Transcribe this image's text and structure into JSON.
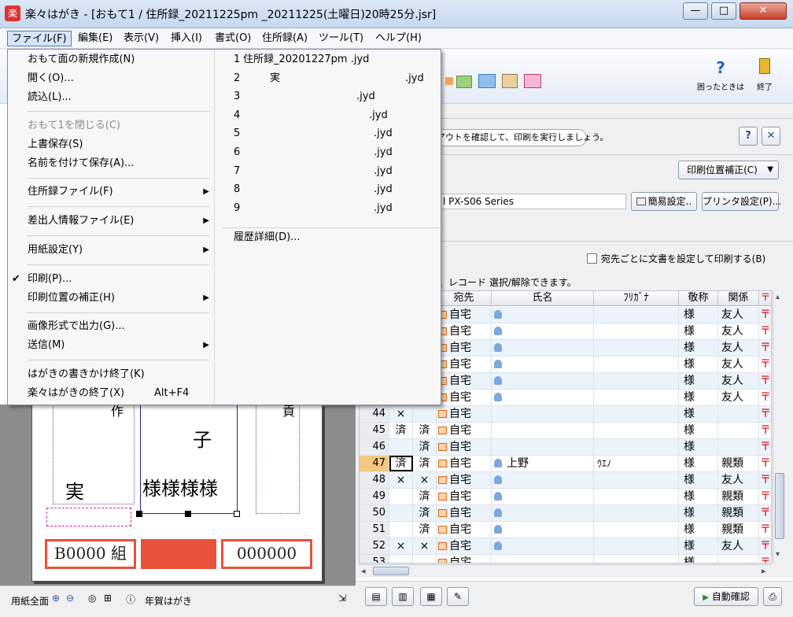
{
  "window": {
    "title": "楽々はがき - [おもて1 / 住所録_20211225pm _20211225(土曜日)20時25分.jsr]",
    "app_icon_char": "楽",
    "minimize": "—",
    "maximize": "□",
    "close": "✕"
  },
  "menubar": [
    "ファイル(F)",
    "編集(E)",
    "表示(V)",
    "挿入(I)",
    "書式(O)",
    "住所録(A)",
    "ツール(T)",
    "ヘルプ(H)"
  ],
  "toolbar": {
    "help_label": "困ったときは",
    "exit_label": "終了"
  },
  "file_menu": {
    "new_front": "おもて面の新規作成(N)",
    "open": "開く(O)...",
    "load": "読込(L)...",
    "close_front": "おもて1を閉じる(C)",
    "save": "上書保存(S)",
    "save_as": "名前を付けて保存(A)...",
    "address_file": "住所録ファイル(F)",
    "sender_file": "差出人情報ファイル(E)",
    "paper_settings": "用紙設定(Y)",
    "print": "印刷(P)...",
    "print_adjust": "印刷位置の補正(H)",
    "export_image": "画像形式で出力(G)...",
    "send": "送信(M)",
    "end_writing": "はがきの書きかけ終了(K)",
    "quit": "楽々はがきの終了(X)",
    "quit_shortcut": "Alt+F4",
    "check_mark": "✔",
    "submenu_arrow": "▶"
  },
  "history": {
    "items": [
      {
        "num": "1",
        "name": "住所録_20201227pm .jyd",
        "ext": ""
      },
      {
        "num": "2",
        "name": "実",
        "ext": ".jyd"
      },
      {
        "num": "3",
        "name": "",
        "ext": ".jyd"
      },
      {
        "num": "4",
        "name": "",
        "ext": ".jyd"
      },
      {
        "num": "5",
        "name": "",
        "ext": ".jyd"
      },
      {
        "num": "6",
        "name": "",
        "ext": ".jyd"
      },
      {
        "num": "7",
        "name": "",
        "ext": ".jyd"
      },
      {
        "num": "8",
        "name": "",
        "ext": ".jyd"
      },
      {
        "num": "9",
        "name": "",
        "ext": ".jyd"
      }
    ],
    "details": "履歴詳細(D)..."
  },
  "print_panel": {
    "guide_text": "アウトを確認して、印刷を実行しましょう。",
    "help_button": "?",
    "close_button": "✕",
    "position_adjust": "印刷位置補正(C)",
    "printer_name": "l PX-S06 Series",
    "simple_settings": "簡易設定..",
    "printer_settings": "プリンタ設定(P)...",
    "per_recipient_checkbox": "宛先ごとに文書を設定して印刷する(B)",
    "hint": "、レコード 選択/解除できます。"
  },
  "grid": {
    "headers": [
      "宛先",
      "氏名",
      "ﾌﾘｶﾞﾅ",
      "敬称",
      "関係",
      "〒"
    ],
    "rows": [
      {
        "no": "",
        "c1": "",
        "c2": "",
        "dest": "自宅",
        "name": "",
        "kana": "",
        "honor": "様",
        "rel": "友人",
        "person": true
      },
      {
        "no": "",
        "c1": "",
        "c2": "",
        "dest": "自宅",
        "name": "",
        "kana": "",
        "honor": "様",
        "rel": "友人",
        "person": true
      },
      {
        "no": "",
        "c1": "",
        "c2": "",
        "dest": "自宅",
        "name": "",
        "kana": "",
        "honor": "様",
        "rel": "友人",
        "person": true
      },
      {
        "no": "",
        "c1": "",
        "c2": "",
        "dest": "自宅",
        "name": "",
        "kana": "",
        "honor": "様",
        "rel": "友人",
        "person": true
      },
      {
        "no": "",
        "c1": "",
        "c2": "",
        "dest": "自宅",
        "name": "",
        "kana": "",
        "honor": "様",
        "rel": "友人",
        "person": true
      },
      {
        "no": "",
        "c1": "",
        "c2": "",
        "dest": "自宅",
        "name": "",
        "kana": "",
        "honor": "様",
        "rel": "友人",
        "person": true
      },
      {
        "no": "44",
        "c1": "×",
        "c2": "",
        "dest": "自宅",
        "name": "",
        "kana": "",
        "honor": "様",
        "rel": "",
        "person": false
      },
      {
        "no": "45",
        "c1": "済",
        "c2": "済",
        "dest": "自宅",
        "name": "",
        "kana": "",
        "honor": "様",
        "rel": "",
        "person": false
      },
      {
        "no": "46",
        "c1": "",
        "c2": "済",
        "dest": "自宅",
        "name": "",
        "kana": "",
        "honor": "様",
        "rel": "",
        "person": false
      },
      {
        "no": "47",
        "c1": "済",
        "c2": "済",
        "dest": "自宅",
        "name": "上野",
        "kana": "ｳｴﾉ",
        "honor": "様",
        "rel": "親類",
        "person": true,
        "selected": true
      },
      {
        "no": "48",
        "c1": "×",
        "c2": "×",
        "dest": "自宅",
        "name": "",
        "kana": "",
        "honor": "様",
        "rel": "友人",
        "person": true
      },
      {
        "no": "49",
        "c1": "",
        "c2": "済",
        "dest": "自宅",
        "name": "",
        "kana": "",
        "honor": "様",
        "rel": "親類",
        "person": true
      },
      {
        "no": "50",
        "c1": "",
        "c2": "済",
        "dest": "自宅",
        "name": "",
        "kana": "",
        "honor": "様",
        "rel": "親類",
        "person": true
      },
      {
        "no": "51",
        "c1": "",
        "c2": "済",
        "dest": "自宅",
        "name": "",
        "kana": "",
        "honor": "様",
        "rel": "親類",
        "person": true
      },
      {
        "no": "52",
        "c1": "×",
        "c2": "×",
        "dest": "自宅",
        "name": "",
        "kana": "",
        "honor": "様",
        "rel": "友人",
        "person": true
      },
      {
        "no": "53",
        "c1": "",
        "c2": "",
        "dest": "自宅",
        "name": "",
        "kana": "",
        "honor": "様",
        "rel": "",
        "person": false
      }
    ],
    "postal_mark": "〒",
    "scroll_left": "◂",
    "scroll_right": "▸",
    "scroll_up": "▴",
    "scroll_down": "▾"
  },
  "bottom_bar": {
    "auto_check": "自動確認"
  },
  "preview": {
    "char_ko": "子",
    "char_jitsu": "実",
    "sama_row": "様様様様",
    "stamp_left": "B0000 組",
    "stamp_right": "000000",
    "top_left_fragment": "作",
    "top_right_fragment": "貢"
  },
  "status": {
    "paper_full": "用紙全面",
    "paper_type": "年賀はがき"
  },
  "colors": {
    "accent_red": "#e8513a",
    "selection_orange": "#f4c880"
  }
}
